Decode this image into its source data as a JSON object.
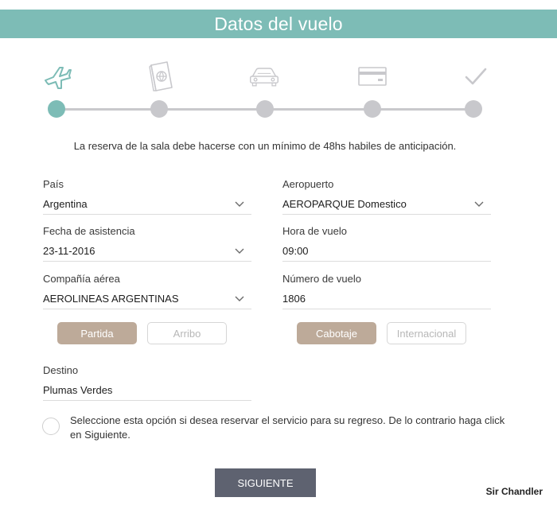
{
  "header": {
    "title": "Datos del vuelo"
  },
  "steps": {
    "icons": [
      "airplane-icon",
      "passport-icon",
      "car-icon",
      "credit-card-icon",
      "checkmark-icon"
    ],
    "active_index": 0,
    "accent_color": "#7dbcb6",
    "inactive_color": "#c8c8cc"
  },
  "notice": "La reserva de la sala debe hacerse con un mínimo de 48hs habiles de anticipación.",
  "form": {
    "pais": {
      "label": "País",
      "value": "Argentina"
    },
    "aeropuerto": {
      "label": "Aeropuerto",
      "value": "AEROPARQUE Domestico"
    },
    "fecha": {
      "label": "Fecha de asistencia",
      "value": "23-11-2016"
    },
    "hora": {
      "label": "Hora de vuelo",
      "value": "09:00"
    },
    "compania": {
      "label": "Compañía aérea",
      "value": "AEROLINEAS ARGENTINAS"
    },
    "numero": {
      "label": "Número de vuelo",
      "value": "1806"
    },
    "destino": {
      "label": "Destino",
      "value": "Plumas Verdes"
    }
  },
  "direction_toggle": {
    "selected": "Partida",
    "options": [
      "Partida",
      "Arribo"
    ]
  },
  "flight_type_toggle": {
    "selected": "Cabotaje",
    "options": [
      "Cabotaje",
      "Internacional"
    ]
  },
  "return_option": {
    "checked": false,
    "text": "Seleccione esta opción si desea reservar el servicio para su regreso. De lo contrario haga click en Siguiente."
  },
  "submit_label": "SIGUIENTE",
  "watermark": "Sir Chandler",
  "colors": {
    "header": "#7dbcb6",
    "toggle_active": "#bdaa99",
    "button": "#5e6270"
  }
}
